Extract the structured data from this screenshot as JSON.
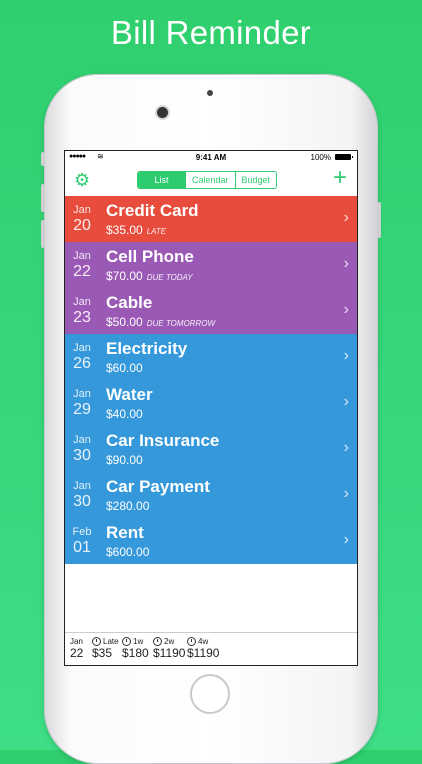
{
  "headline": "Bill Reminder",
  "status": {
    "carrier_dots": "●●●●●",
    "wifi": "≋",
    "time": "9:41 AM",
    "battery": "100%"
  },
  "nav": {
    "gear_icon": "gear-icon",
    "plus_icon": "plus-icon",
    "segments": [
      "List",
      "Calendar",
      "Budget"
    ],
    "active_segment": "List"
  },
  "bills": [
    {
      "month": "Jan",
      "day": "20",
      "name": "Credit Card",
      "amount": "$35.00",
      "note": "LATE",
      "color": "#e74c3c"
    },
    {
      "month": "Jan",
      "day": "22",
      "name": "Cell Phone",
      "amount": "$70.00",
      "note": "DUE TODAY",
      "color": "#9b59b6"
    },
    {
      "month": "Jan",
      "day": "23",
      "name": "Cable",
      "amount": "$50.00",
      "note": "DUE TOMORROW",
      "color": "#9b59b6"
    },
    {
      "month": "Jan",
      "day": "26",
      "name": "Electricity",
      "amount": "$60.00",
      "note": "",
      "color": "#3498db"
    },
    {
      "month": "Jan",
      "day": "29",
      "name": "Water",
      "amount": "$40.00",
      "note": "",
      "color": "#3498db"
    },
    {
      "month": "Jan",
      "day": "30",
      "name": "Car Insurance",
      "amount": "$90.00",
      "note": "",
      "color": "#3498db"
    },
    {
      "month": "Jan",
      "day": "30",
      "name": "Car Payment",
      "amount": "$280.00",
      "note": "",
      "color": "#3498db"
    },
    {
      "month": "Feb",
      "day": "01",
      "name": "Rent",
      "amount": "$600.00",
      "note": "",
      "color": "#3498db"
    }
  ],
  "summary": {
    "date_month": "Jan",
    "date_day": "22",
    "late_label": "Late",
    "late_value": "$35",
    "w1_label": "1w",
    "w1_value": "$180",
    "w2_label": "2w",
    "w2_value": "$1190",
    "w4_label": "4w",
    "w4_value": "$1190"
  },
  "chevron": "›"
}
